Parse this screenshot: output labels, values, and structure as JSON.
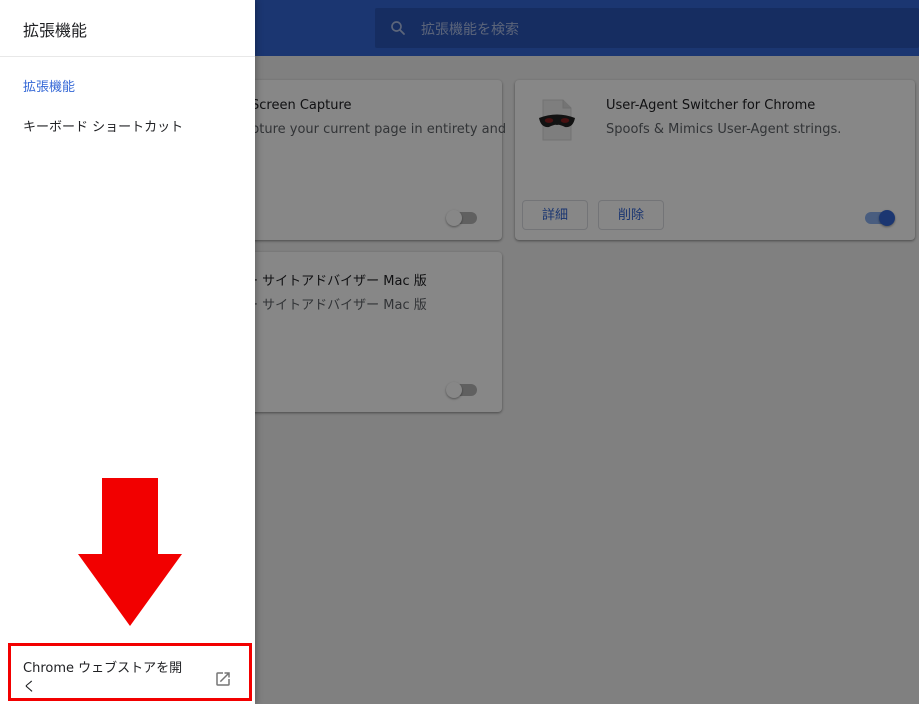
{
  "header": {
    "search_placeholder": "拡張機能を検索"
  },
  "cards": [
    {
      "name": "Screen Capture",
      "description": "pture your current page in entirety and",
      "enabled": false
    },
    {
      "name": "User-Agent Switcher for Chrome",
      "description": "Spoofs & Mimics User-Agent strings.",
      "details_label": "詳細",
      "remove_label": "削除",
      "enabled": true
    },
    {
      "name": "ー サイトアドバイザー Mac 版",
      "description": "ー サイトアドバイザー Mac 版",
      "enabled": false
    }
  ],
  "drawer": {
    "title": "拡張機能",
    "nav": [
      {
        "label": "拡張機能",
        "active": true
      },
      {
        "label": "キーボード ショートカット",
        "active": false
      }
    ],
    "webstore_label": "Chrome ウェブストアを開く"
  },
  "colors": {
    "accent": "#3367d6",
    "highlight": "#f20000"
  },
  "icons": {
    "search": "search-icon",
    "extension_mask": "mask-icon",
    "open_external": "open-in-new-icon",
    "annotation_arrow": "down-arrow-annotation"
  }
}
